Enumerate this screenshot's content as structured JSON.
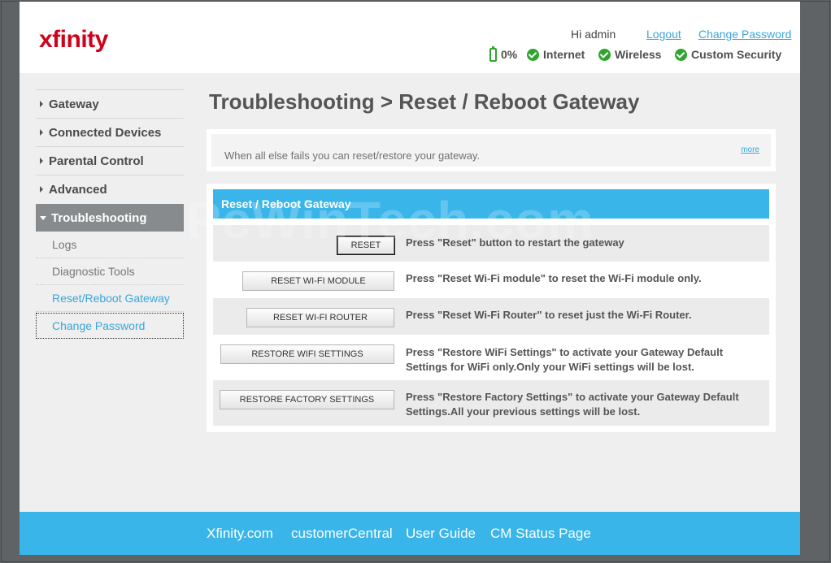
{
  "header": {
    "logo": "xfinity",
    "greeting": "Hi admin",
    "logout": "Logout",
    "change_password": "Change Password",
    "status": {
      "battery": "0%",
      "internet": "Internet",
      "wireless": "Wireless",
      "security": "Custom Security"
    }
  },
  "sidebar": {
    "items": [
      {
        "label": "Gateway"
      },
      {
        "label": "Connected Devices"
      },
      {
        "label": "Parental Control"
      },
      {
        "label": "Advanced"
      },
      {
        "label": "Troubleshooting"
      }
    ],
    "subitems": [
      {
        "label": "Logs"
      },
      {
        "label": "Diagnostic Tools"
      },
      {
        "label": "Reset/Reboot Gateway"
      },
      {
        "label": "Change Password"
      }
    ]
  },
  "main": {
    "title": "Troubleshooting > Reset / Reboot Gateway",
    "info": "When all else fails you can reset/restore your gateway.",
    "more": "more",
    "panel_title": "Reset / Reboot Gateway",
    "rows": [
      {
        "button": "RESET",
        "desc": "Press \"Reset\" button to restart the gateway"
      },
      {
        "button": "RESET WI-FI MODULE",
        "desc": "Press \"Reset Wi-Fi module\" to reset the Wi-Fi module only."
      },
      {
        "button": "RESET WI-FI ROUTER",
        "desc": "Press \"Reset Wi-Fi Router\" to reset just the Wi-Fi Router."
      },
      {
        "button": "RESTORE WIFI SETTINGS",
        "desc": "Press \"Restore WiFi Settings\" to activate your Gateway Default Settings for WiFi only.Only your WiFi settings will be lost."
      },
      {
        "button": "RESTORE FACTORY SETTINGS",
        "desc": "Press \"Restore Factory Settings\" to activate your Gateway Default Settings.All your previous settings will be lost."
      }
    ]
  },
  "watermark": "PcWinTech.com",
  "footer": {
    "links": [
      "Xfinity.com",
      "customerCentral",
      "User Guide",
      "CM Status Page"
    ]
  },
  "colors": {
    "accent": "#39b5ea",
    "brand": "#d0021b",
    "status_ok": "#2ea52e",
    "nav_active": "#888b8d"
  }
}
